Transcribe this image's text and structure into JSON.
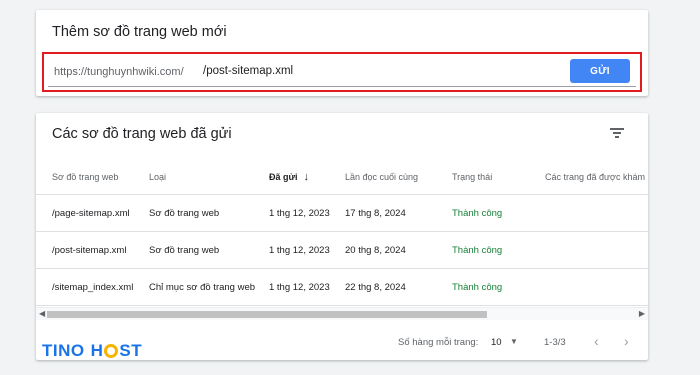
{
  "add_sitemap": {
    "title": "Thêm sơ đồ trang web mới",
    "url_prefix": "https://tunghuynhwiki.com/",
    "url_value": "/post-sitemap.xml",
    "submit_label": "GỬI",
    "highlight_color": "#e11b22",
    "button_color": "#4285f4"
  },
  "submitted": {
    "title": "Các sơ đồ trang web đã gửi",
    "filter_icon": "filter-icon",
    "columns": [
      "Sơ đồ trang web",
      "Loại",
      "Đã gửi",
      "Lần đọc cuối cùng",
      "Trạng thái",
      "Các trang đã được khám p"
    ],
    "sorted_column": "Đã gửi",
    "sort_direction": "descending",
    "rows": [
      {
        "sitemap": "/page-sitemap.xml",
        "type": "Sơ đồ trang web",
        "submitted": "1 thg 12, 2023",
        "last_read": "17 thg 8, 2024",
        "status": "Thành công"
      },
      {
        "sitemap": "/post-sitemap.xml",
        "type": "Sơ đồ trang web",
        "submitted": "1 thg 12, 2023",
        "last_read": "20 thg 8, 2024",
        "status": "Thành công"
      },
      {
        "sitemap": "/sitemap_index.xml",
        "type": "Chỉ mục sơ đồ trang web",
        "submitted": "1 thg 12, 2023",
        "last_read": "22 thg 8, 2024",
        "status": "Thành công"
      }
    ],
    "status_color": "#188038"
  },
  "pagination": {
    "rows_per_page_label": "Số hàng mỗi trang:",
    "rows_per_page_value": "10",
    "range": "1-3/3",
    "prev_icon": "chevron-left-icon",
    "next_icon": "chevron-right-icon"
  },
  "watermark": {
    "text_left": "TINO",
    "text_right": "HOST"
  }
}
